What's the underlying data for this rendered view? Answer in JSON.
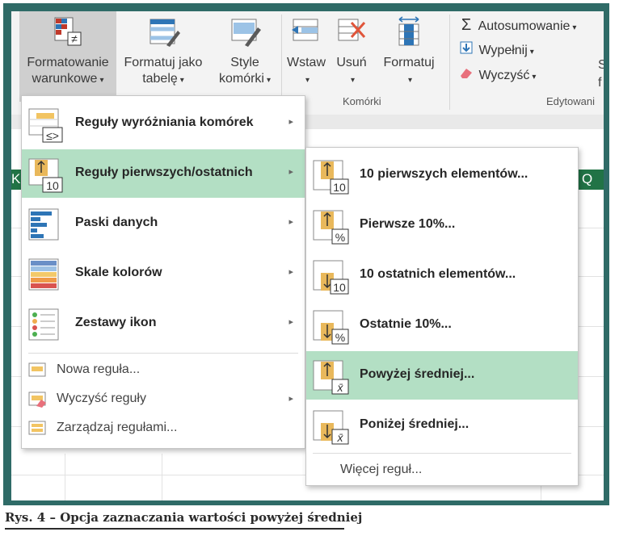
{
  "ribbon": {
    "conditional_formatting": {
      "line1": "Formatowanie",
      "line2": "warunkowe"
    },
    "format_as_table": {
      "line1": "Formatuj jako",
      "line2": "tabelę"
    },
    "cell_styles": {
      "line1": "Style",
      "line2": "komórki"
    },
    "insert": "Wstaw",
    "delete": "Usuń",
    "format": "Formatuj",
    "cells_group": "Komórki",
    "editing_group": "Edytowani",
    "autosum": "Autosumowanie",
    "fill": "Wypełnij",
    "clear": "Wyczyść",
    "partial_f": "f",
    "partial_s": "S"
  },
  "sheet": {
    "col_k": "K",
    "col_q": "Q"
  },
  "main_menu": {
    "items": [
      {
        "label": "Reguły wyróżniania komórek",
        "icon": "highlight-cells-rules-icon"
      },
      {
        "label": "Reguły pierwszych/ostatnich",
        "icon": "top-bottom-rules-icon"
      },
      {
        "label": "Paski danych",
        "icon": "data-bars-icon"
      },
      {
        "label": "Skale kolorów",
        "icon": "color-scales-icon"
      },
      {
        "label": "Zestawy ikon",
        "icon": "icon-sets-icon"
      }
    ],
    "small_items": [
      {
        "label": "Nowa reguła..."
      },
      {
        "label": "Wyczyść reguły"
      },
      {
        "label": "Zarządzaj regułami..."
      }
    ]
  },
  "sub_menu": {
    "items": [
      {
        "label": "10 pierwszych elementów...",
        "badge": "10"
      },
      {
        "label": "Pierwsze 10%...",
        "badge": "%"
      },
      {
        "label": "10 ostatnich elementów...",
        "badge": "10"
      },
      {
        "label": "Ostatnie 10%...",
        "badge": "%"
      },
      {
        "label": "Powyżej średniej...",
        "badge": "x̄"
      },
      {
        "label": "Poniżej średniej...",
        "badge": "x̄"
      }
    ],
    "more": "Więcej reguł..."
  },
  "caption": "Rys. 4 – Opcja zaznaczania wartości powyżej średniej",
  "colors": {
    "frame": "#2f6b67",
    "highlight": "#b3dfc4",
    "excel_green": "#217346"
  }
}
